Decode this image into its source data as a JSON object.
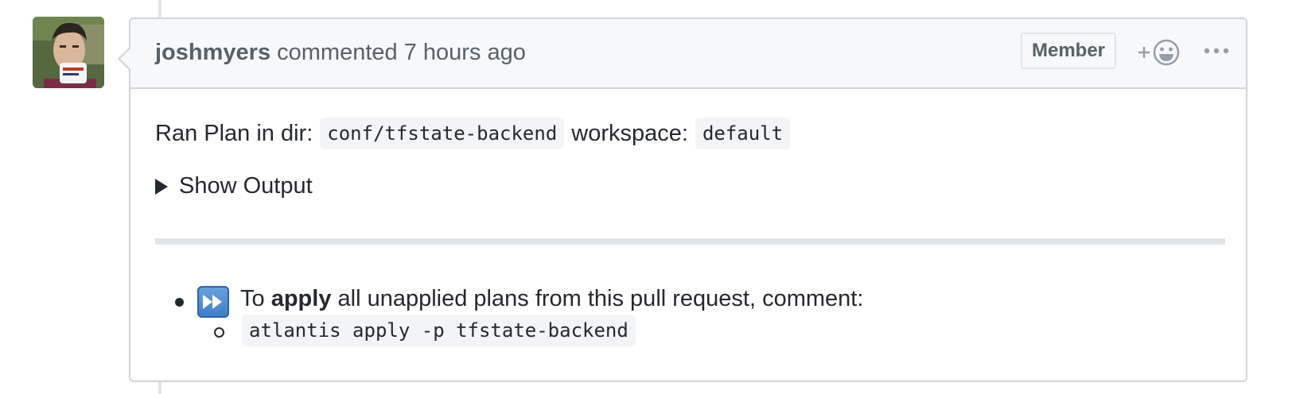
{
  "comment": {
    "author": "joshmyers",
    "action": "commented",
    "time": "7 hours ago",
    "badge": "Member",
    "icons": {
      "reaction": "add-reaction-icon",
      "more": "more-options-icon",
      "avatar": "user-avatar"
    }
  },
  "body": {
    "ran_prefix": "Ran Plan in dir:",
    "dir": "conf/tfstate-backend",
    "workspace_label": "workspace:",
    "workspace": "default",
    "details_summary": "Show Output",
    "apply_prefix": "To",
    "apply_bold": "apply",
    "apply_suffix": "all unapplied plans from this pull request, comment:",
    "apply_command": "atlantis apply -p tfstate-backend",
    "emoji": "fast-forward-icon"
  },
  "colors": {
    "border": "#d1d5da",
    "header_bg": "#f6f8fa",
    "text": "#24292e",
    "muted": "#586069",
    "code_bg": "#f3f4f6"
  }
}
